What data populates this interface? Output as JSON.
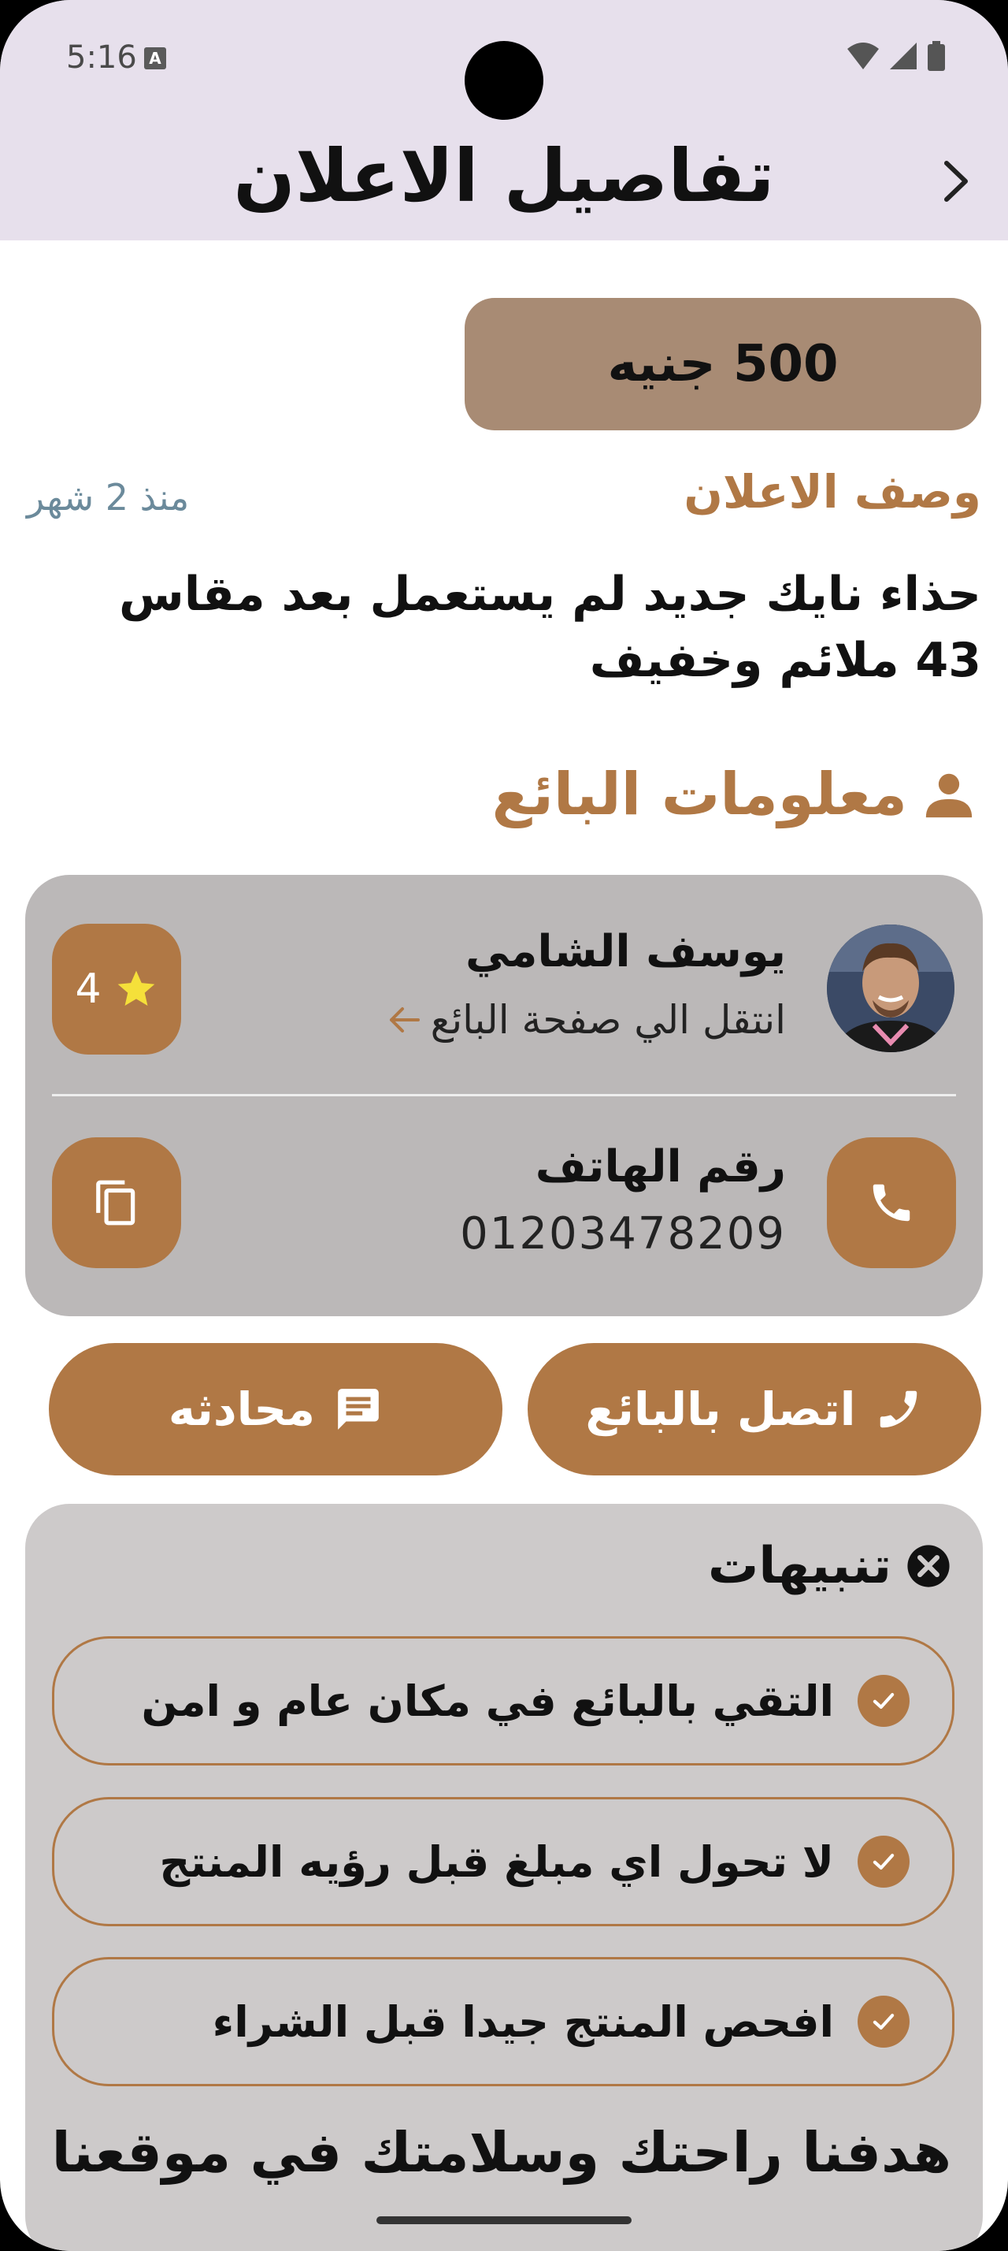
{
  "status_bar": {
    "time": "5:16",
    "a_badge": "A"
  },
  "header": {
    "title": "تفاصيل الاعلان"
  },
  "listing": {
    "price": "500 جنيه",
    "description_title": "وصف الاعلان",
    "posted_ago": "منذ 2 شهر",
    "description": "حذاء نايك جديد لم يستعمل بعد مقاس 43 ملائم وخفيف"
  },
  "seller": {
    "section_title": "معلومات البائع",
    "name": "يوسف الشامي",
    "profile_link": "انتقل الي صفحة البائع",
    "rating": "4",
    "phone_label": "رقم الهاتف",
    "phone_number": "01203478209"
  },
  "actions": {
    "call_label": "اتصل بالبائع",
    "chat_label": "محادثه"
  },
  "alerts": {
    "title": "تنبيهات",
    "items": [
      "التقي بالبائع في مكان عام و امن",
      "لا تحول اي مبلغ قبل رؤيه المنتج",
      "افحص المنتج جيدا قبل الشراء"
    ],
    "footer": "هدفنا راحتك وسلامتك في موقعنا"
  },
  "colors": {
    "accent": "#b07845",
    "price_bg": "#a88b74",
    "card_bg": "#bbb8b8",
    "header_bg": "#e7e0ec"
  }
}
